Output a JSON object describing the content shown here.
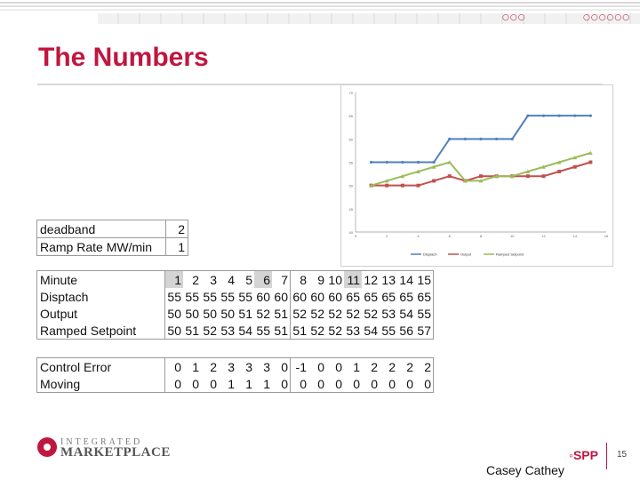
{
  "slide": {
    "title": "The Numbers",
    "page_number": "15",
    "author": "Casey Cathey",
    "logo_line1": "INTEGRATED",
    "logo_line2": "MARKETPLACE",
    "brand_mark": "SPP",
    "decor_dots_left": "○○○",
    "decor_dots_right": "○○○○○○"
  },
  "params": [
    {
      "label": "deadband",
      "value": "2"
    },
    {
      "label": "Ramp Rate MW/min",
      "value": "1"
    }
  ],
  "table": {
    "rows": [
      {
        "label": "Minute",
        "values": [
          "1",
          "2",
          "3",
          "4",
          "5",
          "6",
          "7",
          "8",
          "9",
          "10",
          "11",
          "12",
          "13",
          "14",
          "15"
        ]
      },
      {
        "label": "Disptach",
        "values": [
          "55",
          "55",
          "55",
          "55",
          "55",
          "60",
          "60",
          "60",
          "60",
          "60",
          "65",
          "65",
          "65",
          "65",
          "65"
        ]
      },
      {
        "label": "Output",
        "values": [
          "50",
          "50",
          "50",
          "50",
          "51",
          "52",
          "51",
          "52",
          "52",
          "52",
          "52",
          "52",
          "53",
          "54",
          "55"
        ]
      },
      {
        "label": "Ramped Setpoint",
        "values": [
          "50",
          "51",
          "52",
          "53",
          "54",
          "55",
          "51",
          "51",
          "52",
          "52",
          "53",
          "54",
          "55",
          "56",
          "57"
        ]
      }
    ],
    "rows2": [
      {
        "label": "Control Error",
        "values": [
          "0",
          "1",
          "2",
          "3",
          "3",
          "3",
          "0",
          "-1",
          "0",
          "0",
          "1",
          "2",
          "2",
          "2",
          "2"
        ]
      },
      {
        "label": "Moving",
        "values": [
          "0",
          "0",
          "0",
          "1",
          "1",
          "1",
          "0",
          "0",
          "0",
          "0",
          "0",
          "0",
          "0",
          "0",
          "0"
        ]
      }
    ],
    "highlighted_minutes": [
      "1",
      "6",
      "11"
    ]
  },
  "chart_data": {
    "type": "line",
    "x": [
      1,
      2,
      3,
      4,
      5,
      6,
      7,
      8,
      9,
      10,
      11,
      12,
      13,
      14,
      15
    ],
    "series": [
      {
        "name": "Disptach",
        "color": "#4f81bd",
        "values": [
          55,
          55,
          55,
          55,
          55,
          60,
          60,
          60,
          60,
          60,
          65,
          65,
          65,
          65,
          65
        ]
      },
      {
        "name": "Output",
        "color": "#c0504d",
        "values": [
          50,
          50,
          50,
          50,
          51,
          52,
          51,
          52,
          52,
          52,
          52,
          52,
          53,
          54,
          55
        ]
      },
      {
        "name": "Ramped Setpoint",
        "color": "#9bbb59",
        "values": [
          50,
          51,
          52,
          53,
          54,
          55,
          51,
          51,
          52,
          52,
          53,
          54,
          55,
          56,
          57
        ]
      }
    ],
    "ylim": [
      40,
      70
    ],
    "yticks": [
      "40",
      "45",
      "50",
      "55",
      "60",
      "65",
      "70"
    ],
    "xlim": [
      0,
      16
    ],
    "xticks": [
      "0",
      "2",
      "4",
      "6",
      "8",
      "10",
      "12",
      "14",
      "16"
    ],
    "legend": "bottom",
    "grid": false
  }
}
